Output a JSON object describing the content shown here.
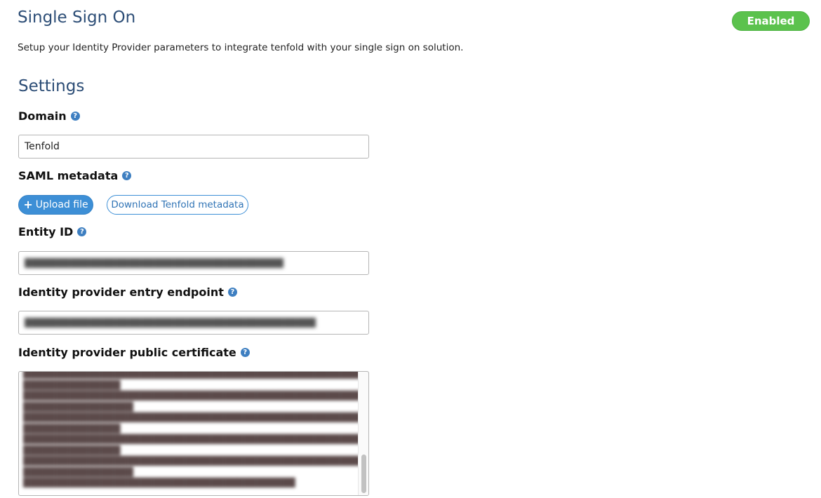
{
  "header": {
    "title": "Single Sign On",
    "status": "Enabled",
    "description": "Setup your Identity Provider parameters to integrate tenfold with your single sign on solution."
  },
  "settings": {
    "title": "Settings",
    "domain": {
      "label": "Domain",
      "value": "Tenfold"
    },
    "saml_metadata": {
      "label": "SAML metadata",
      "upload_label": "Upload file",
      "download_label": "Download Tenfold metadata"
    },
    "entity_id": {
      "label": "Entity ID"
    },
    "entry_endpoint": {
      "label": "Identity provider entry endpoint"
    },
    "public_certificate": {
      "label": "Identity provider public certificate"
    }
  },
  "icons": {
    "help": "question-circle-icon",
    "plus": "plus-icon"
  },
  "colors": {
    "title": "#2c4d76",
    "enabled": "#5bc24d",
    "primary": "#3d8fd6",
    "help_icon": "#3e7fc1"
  }
}
